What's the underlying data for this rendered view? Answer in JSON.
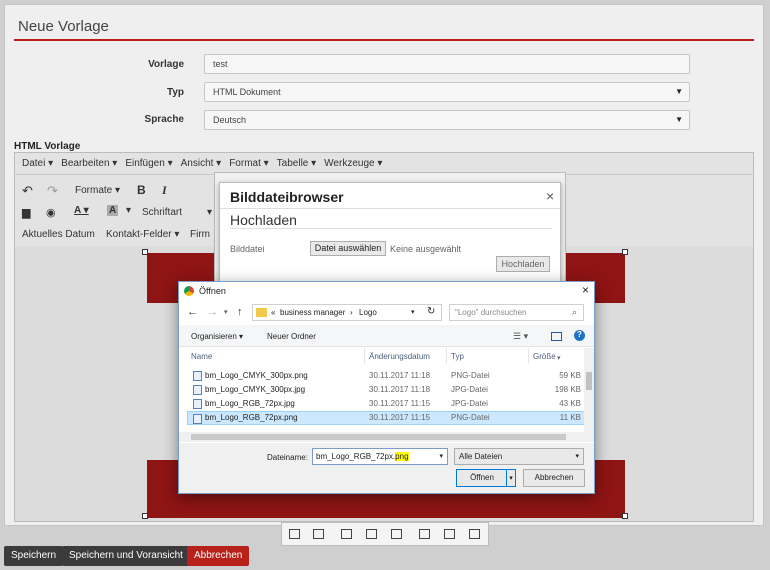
{
  "page": {
    "title": "Neue Vorlage"
  },
  "form": {
    "vorlage_label": "Vorlage",
    "vorlage_value": "test",
    "typ_label": "Typ",
    "typ_value": "HTML Dokument",
    "sprache_label": "Sprache",
    "sprache_value": "Deutsch",
    "html_label": "HTML Vorlage"
  },
  "editor": {
    "menus": [
      "Datei ▾",
      "Bearbeiten ▾",
      "Einfügen ▾",
      "Ansicht ▾",
      "Format ▾",
      "Tabelle ▾",
      "Werkzeuge ▾"
    ],
    "formate": "Formate",
    "schriftart": "Schriftart",
    "aktuelles_datum": "Aktuelles Datum",
    "kontakt_felder": "Kontakt-Felder ▾",
    "firma": "Firm"
  },
  "bilddatei": {
    "title": "Bilddateibrowser",
    "section": "Hochladen",
    "label": "Bilddatei",
    "choose_button": "Datei auswählen",
    "no_file": "Keine ausgewählt",
    "upload_button": "Hochladen"
  },
  "open_dialog": {
    "title": "Öffnen",
    "path": [
      "business manager",
      "Logo"
    ],
    "path_prefix": "«",
    "search_placeholder": "\"Logo\" durchsuchen",
    "organize": "Organisieren ▾",
    "new_folder": "Neuer Ordner",
    "columns": {
      "name": "Name",
      "date": "Änderungsdatum",
      "type": "Typ",
      "size": "Größe"
    },
    "files": [
      {
        "name": "bm_Logo_CMYK_300px.png",
        "date": "30.11.2017 11:18",
        "type": "PNG-Datei",
        "size": "59 KB"
      },
      {
        "name": "bm_Logo_CMYK_300px.jpg",
        "date": "30.11.2017 11:18",
        "type": "JPG-Datei",
        "size": "198 KB"
      },
      {
        "name": "bm_Logo_RGB_72px.jpg",
        "date": "30.11.2017 11:15",
        "type": "JPG-Datei",
        "size": "43 KB"
      },
      {
        "name": "bm_Logo_RGB_72px.png",
        "date": "30.11.2017 11:15",
        "type": "PNG-Datei",
        "size": "11 KB"
      }
    ],
    "filename_label": "Dateiname:",
    "filename_value": "bm_Logo_RGB_72px.",
    "filename_ext": "png",
    "filter": "Alle Dateien",
    "open_button": "Öffnen",
    "cancel_button": "Abbrechen"
  },
  "footer": {
    "save": "Speichern",
    "save_preview": "Speichern und Voransicht",
    "cancel": "Abbrechen"
  },
  "colors": {
    "accent": "#b81c1c",
    "dark_button": "#3b3b3b",
    "danger_button": "#b8201a"
  }
}
